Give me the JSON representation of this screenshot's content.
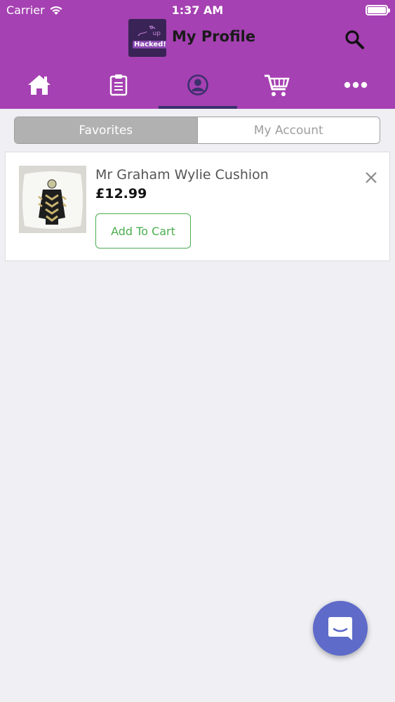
{
  "status_bar": {
    "carrier": "Carrier",
    "time": "1:37 AM",
    "battery_level": 1.0
  },
  "header": {
    "title": "My Profile",
    "logo_text": "Hacked!",
    "logo_superscript": "up",
    "search_icon": "search-icon"
  },
  "tabs": [
    {
      "icon": "home-icon",
      "active": false
    },
    {
      "icon": "clipboard-icon",
      "active": false
    },
    {
      "icon": "profile-icon",
      "active": true
    },
    {
      "icon": "cart-icon",
      "active": false
    },
    {
      "icon": "more-icon",
      "active": false
    }
  ],
  "segmented": {
    "favorites_label": "Favorites",
    "account_label": "My Account",
    "selected": "Favorites"
  },
  "favorites": [
    {
      "name": "Mr Graham Wylie Cushion",
      "price": "£12.99",
      "add_label": "Add To Cart"
    }
  ],
  "colors": {
    "header_bg": "#a541b2",
    "tab_indicator": "#3c2f6e",
    "add_to_cart": "#4cae50",
    "chat_fab": "#5e6bc9"
  }
}
